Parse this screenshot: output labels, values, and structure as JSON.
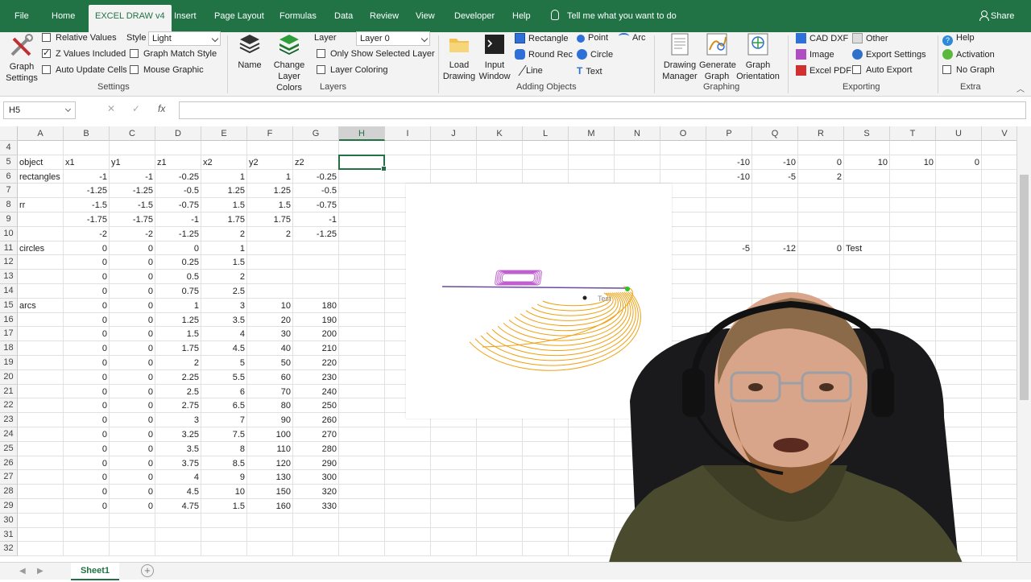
{
  "tabs": {
    "file": "File",
    "home": "Home",
    "excel_draw": "EXCEL DRAW v4",
    "insert": "Insert",
    "page_layout": "Page Layout",
    "formulas": "Formulas",
    "data": "Data",
    "review": "Review",
    "view": "View",
    "developer": "Developer",
    "help": "Help",
    "tell_me": "Tell me what you want to do",
    "share": "Share"
  },
  "ribbon": {
    "settings": {
      "graph_settings": [
        "Graph",
        "Settings"
      ],
      "relative_values": "Relative Values",
      "z_values_included": "Z Values Included",
      "auto_update_cells": "Auto Update Cells",
      "style_label": "Style",
      "style_value": "Light",
      "graph_match_style": "Graph Match Style",
      "mouse_graphic": "Mouse Graphic",
      "group_label": "Settings"
    },
    "layers": {
      "name": "Name",
      "change_layer_colors": [
        "Change",
        "Layer Colors"
      ],
      "layer_label": "Layer",
      "layer_value": "Layer 0",
      "only_show_selected": "Only Show Selected Layer",
      "layer_coloring": "Layer Coloring",
      "group_label": "Layers"
    },
    "adding": {
      "load_drawing": [
        "Load",
        "Drawing"
      ],
      "input_window": [
        "Input",
        "Window"
      ],
      "rectangle": "Rectangle",
      "round_rec": "Round Rec",
      "line": "Line",
      "point": "Point",
      "circle": "Circle",
      "text": "Text",
      "arc": "Arc",
      "group_label": "Adding Objects"
    },
    "graphing": {
      "drawing_manager": [
        "Drawing",
        "Manager"
      ],
      "generate_graph": [
        "Generate",
        "Graph"
      ],
      "graph_orientation": [
        "Graph",
        "Orientation"
      ],
      "group_label": "Graphing"
    },
    "exporting": {
      "cad_dxf": "CAD DXF",
      "image": "Image",
      "excel_pdf": "Excel PDF",
      "other": "Other",
      "export_settings": "Export Settings",
      "auto_export": "Auto Export",
      "group_label": "Exporting"
    },
    "extra": {
      "help": "Help",
      "activation": "Activation",
      "no_graph": "No Graph",
      "group_label": "Extra"
    }
  },
  "formula_bar": {
    "name_box": "H5",
    "fx": "fx",
    "formula": ""
  },
  "columns": [
    "A",
    "B",
    "C",
    "D",
    "E",
    "F",
    "G",
    "H",
    "I",
    "J",
    "K",
    "L",
    "M",
    "N",
    "O",
    "P",
    "Q",
    "R",
    "S",
    "T",
    "U",
    "V"
  ],
  "rows": [
    "4",
    "5",
    "6",
    "7",
    "8",
    "9",
    "10",
    "11",
    "12",
    "13",
    "14",
    "15",
    "16",
    "17",
    "18",
    "19",
    "20",
    "21",
    "22",
    "23",
    "24",
    "25",
    "26",
    "27",
    "28",
    "29",
    "30",
    "31",
    "32"
  ],
  "cells": {
    "5": {
      "A": "object",
      "B": "x1",
      "C": "y1",
      "D": "z1",
      "E": "x2",
      "F": "y2",
      "G": "z2",
      "P": "-10",
      "Q": "-10",
      "R": "0",
      "S": "10",
      "T": "10",
      "U": "0"
    },
    "6": {
      "A": "rectangles",
      "B": "-1",
      "C": "-1",
      "D": "-0.25",
      "E": "1",
      "F": "1",
      "G": "-0.25",
      "P": "-10",
      "Q": "-5",
      "R": "2"
    },
    "7": {
      "B": "-1.25",
      "C": "-1.25",
      "D": "-0.5",
      "E": "1.25",
      "F": "1.25",
      "G": "-0.5"
    },
    "8": {
      "A": "rr",
      "B": "-1.5",
      "C": "-1.5",
      "D": "-0.75",
      "E": "1.5",
      "F": "1.5",
      "G": "-0.75"
    },
    "9": {
      "B": "-1.75",
      "C": "-1.75",
      "D": "-1",
      "E": "1.75",
      "F": "1.75",
      "G": "-1"
    },
    "10": {
      "B": "-2",
      "C": "-2",
      "D": "-1.25",
      "E": "2",
      "F": "2",
      "G": "-1.25"
    },
    "11": {
      "A": "circles",
      "B": "0",
      "C": "0",
      "D": "0",
      "E": "1",
      "P": "-5",
      "Q": "-12",
      "R": "0",
      "S": "Test"
    },
    "12": {
      "B": "0",
      "C": "0",
      "D": "0.25",
      "E": "1.5"
    },
    "13": {
      "B": "0",
      "C": "0",
      "D": "0.5",
      "E": "2"
    },
    "14": {
      "B": "0",
      "C": "0",
      "D": "0.75",
      "E": "2.5"
    },
    "15": {
      "A": "arcs",
      "B": "0",
      "C": "0",
      "D": "1",
      "E": "3",
      "F": "10",
      "G": "180"
    },
    "16": {
      "B": "0",
      "C": "0",
      "D": "1.25",
      "E": "3.5",
      "F": "20",
      "G": "190"
    },
    "17": {
      "B": "0",
      "C": "0",
      "D": "1.5",
      "E": "4",
      "F": "30",
      "G": "200"
    },
    "18": {
      "B": "0",
      "C": "0",
      "D": "1.75",
      "E": "4.5",
      "F": "40",
      "G": "210"
    },
    "19": {
      "B": "0",
      "C": "0",
      "D": "2",
      "E": "5",
      "F": "50",
      "G": "220"
    },
    "20": {
      "B": "0",
      "C": "0",
      "D": "2.25",
      "E": "5.5",
      "F": "60",
      "G": "230"
    },
    "21": {
      "B": "0",
      "C": "0",
      "D": "2.5",
      "E": "6",
      "F": "70",
      "G": "240"
    },
    "22": {
      "B": "0",
      "C": "0",
      "D": "2.75",
      "E": "6.5",
      "F": "80",
      "G": "250"
    },
    "23": {
      "B": "0",
      "C": "0",
      "D": "3",
      "E": "7",
      "F": "90",
      "G": "260"
    },
    "24": {
      "B": "0",
      "C": "0",
      "D": "3.25",
      "E": "7.5",
      "F": "100",
      "G": "270"
    },
    "25": {
      "B": "0",
      "C": "0",
      "D": "3.5",
      "E": "8",
      "F": "110",
      "G": "280"
    },
    "26": {
      "B": "0",
      "C": "0",
      "D": "3.75",
      "E": "8.5",
      "F": "120",
      "G": "290"
    },
    "27": {
      "B": "0",
      "C": "0",
      "D": "4",
      "E": "9",
      "F": "130",
      "G": "300"
    },
    "28": {
      "B": "0",
      "C": "0",
      "D": "4.5",
      "E": "10",
      "F": "150",
      "G": "320"
    },
    "29": {
      "B": "0",
      "C": "0",
      "D": "4.75",
      "E": "1.5",
      "F": "160",
      "G": "330"
    }
  },
  "chart": {
    "label": "Test",
    "colors": {
      "rect": "#c060d0",
      "arc": "#f0a010",
      "line": "#6a4aa0",
      "point": "#30c030"
    }
  },
  "sheet_tab": "Sheet1",
  "colors": {
    "accent": "#217346",
    "ribbon": "#f3f3f3"
  }
}
